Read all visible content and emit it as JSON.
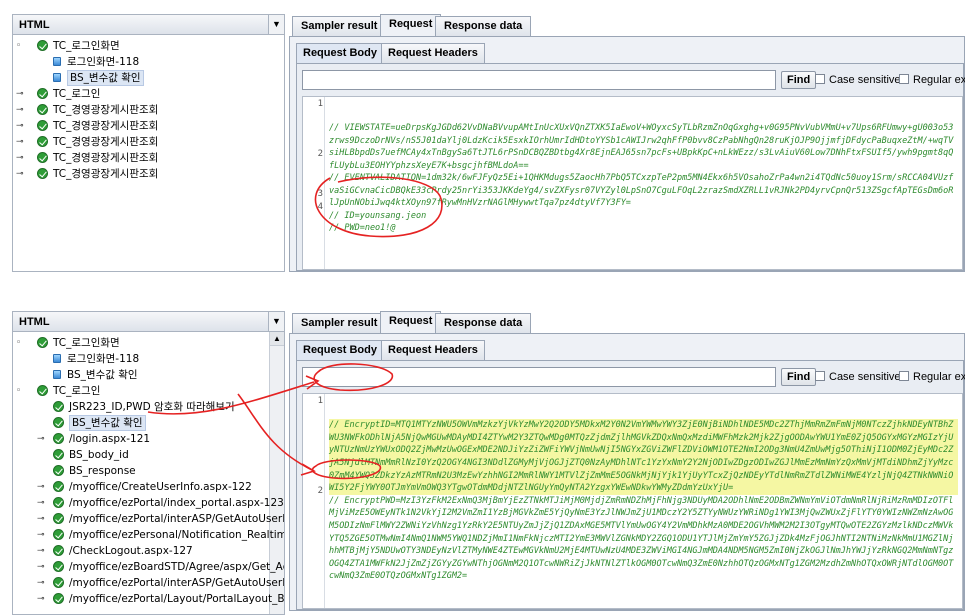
{
  "panel1": {
    "tree": {
      "header": "HTML",
      "nodes": [
        {
          "label": "TC_로그인화면"
        },
        {
          "label": "로그인화면-118"
        },
        {
          "label": "BS_변수값 확인"
        },
        {
          "label": "TC_로그인"
        },
        {
          "label": "TC_경영광장게시판조회"
        },
        {
          "label": "TC_경영광장게시판조회"
        },
        {
          "label": "TC_경영광장게시판조회"
        },
        {
          "label": "TC_경영광장게시판조회"
        },
        {
          "label": "TC_경영광장게시판조회"
        }
      ]
    },
    "tabs": [
      "Sampler result",
      "Request",
      "Response data"
    ],
    "subtabs": [
      "Request Body",
      "Request Headers"
    ],
    "find": {
      "button": "Find",
      "case": "Case sensitive",
      "regex": "Regular exp."
    },
    "lines": [
      {
        "n": "1",
        "text": "// VIEWSTATE=ueDrpsKgJGDd62VvDNaBVvupAMtInUcXUxVQnZTXK5IaEwoV+WOyxcSyTLbRzmZnOqGxghg+v0G95PNvVubVMmU+v7Ups6RFUmwy+gU003o53zrws9DczoDrNVs/nS5J01daYlj0LdzKcik5EsxkIOrhUmrIdHDtoYYSb1cAWIJrw2qhFfP0bvv8CzPabNhgQn28ruKjOJP9OjjmfjDFdycPaBuqxeZtM/+wqTVsiHLBbpdDs7uefMCAy4xTnBgySa6TtJTL6rPSnDCBQZBDtbg4Xr8EjnEAJ65sn7pcFs+UBpkKpC+nLkWEzz/s3LvAiuV60Low7DNhFtxFSUIf5/ywh9pgmt8qQfLUybLu3EOHYYphzsXeyE7K+bsgcjhfBMLdoA=="
      },
      {
        "n": "2",
        "text": "// EVENTVALIDATION=1dm32k/6wFJFyQz5Ei+1QHKMdugs5ZaocHh7PbQ5TCxzpTeP2pm5MN4Ekx6h5VOsahoZrPa4wn2i4TQdNc50uoy1Srm/sRCCA04VUzfvaSiGCvnaCicDBQkE33cPrdy25nrYi353JKKdeYg4/svZXFysr07VYZyl0LpSnO7CguLFOqL2zrazSmdXZRLL1vRJNk2PD4yrvCpnQr513ZSgcfApTEGsDm6oRlJpUnNObiJwq4ktXOyn97fRywMnHVzrNAGlMHywwtTqa7pz4dtyVf7Y3FY="
      },
      {
        "n": "3",
        "text": "// ID=younsang.jeon"
      },
      {
        "n": "4",
        "text": "// PWD=neo1!@"
      }
    ]
  },
  "panel2": {
    "tree": {
      "header": "HTML",
      "nodes": [
        {
          "label": "TC_로그인화면"
        },
        {
          "label": "로그인화면-118"
        },
        {
          "label": "BS_변수값 확인"
        },
        {
          "label": "TC_로그인"
        },
        {
          "label": "JSR223_ID,PWD 암호화 따라해보기"
        },
        {
          "label": "BS_변수값 확인"
        },
        {
          "label": "/login.aspx-121"
        },
        {
          "label": "BS_body_id"
        },
        {
          "label": "BS_response"
        },
        {
          "label": "/myoffice/CreateUserInfo.aspx-122"
        },
        {
          "label": "/myoffice/ezPortal/index_portal.aspx-123"
        },
        {
          "label": "/myoffice/ezPortal/interASP/GetAutoUserLoc"
        },
        {
          "label": "/myoffice/ezPersonal/Notification_Realtime"
        },
        {
          "label": "/CheckLogout.aspx-127"
        },
        {
          "label": "/myoffice/ezBoardSTD/Agree/aspx/Get_Agre"
        },
        {
          "label": "/myoffice/ezPortal/interASP/GetAutoUserLoc"
        },
        {
          "label": "/myoffice/ezPortal/Layout/PortalLayout_Bas"
        }
      ]
    },
    "tabs": [
      "Sampler result",
      "Request",
      "Response data"
    ],
    "subtabs": [
      "Request Body",
      "Request Headers"
    ],
    "find": {
      "button": "Find",
      "case": "Case sensitive",
      "regex": "Regular ex"
    },
    "lines": [
      {
        "n": "1",
        "text": "// EncryptID=MTQ1MTYzNWU5OWVmMzkzYjVkYzMwY2Q2ODY5MDkxM2Y0N2VmYWMwYWY3ZjE0NjBiNDhlNDE5MDc2ZThjMmRmZmFmNjM0NTczZjhkNDEyNTBhZWU3NWFkODhlNjA5NjQwMGUwMDAyMDI4ZTYwM2Y3ZTQwMDg0MTQzZjdmZjlhMGVkZDQxNmQxMzdiMWFhMzk2Mjk2ZjgOODAwYWU1YmE0ZjQ5OGYxMGYzMGIzYjUyNTUzNmUzYWUxODQ2ZjMwMzUwOGExMDE2NDJiYzZiZWFiYWVjNmUwNjI5NGYxZGViZWFlZDViOWM1OTE2NmI2ODg3NmU4ZmUwMjg5OThiNjI1ODM0ZjEyMDc2ZjA5NjdlMTNmMmRlNzI0YzQ2OGY4NGI3NDdlZGMyMjVjOGJjZTQ0NzAyMDhlNTc1YzYxNmY2Y2NjODIwZDgzODIwZGJlMmEzMmNmYzQxMmVjMTdiNDhmZjYyMzc0ZmM4YWQ3ZDkzYzAzMTRmN2U3MzEwYzhhNGI2MmRlNWY1MTVlZjZmMmE5OGNkMjNjYjk1YjUyYTcxZjQzNDEyYTdlNmRmZTdlZWNiMWE4YzljNjQ4ZTNkNWNiOWI5Y2FjYWY0OTJmYmVmOWQ3YTgwOTdmMDdjNTZlNGUyYmQyNTA2YzgxYWEwNDkwYWMyZDdmYzUxYjU="
      },
      {
        "n": "2",
        "text": "// EncryptPWD=MzI3YzFkM2ExNmQ3MjBmYjEzZTNkMTJiMjM0MjdjZmRmNDZhMjFhNjg3NDUyMDA2ODhlNmE2ODBmZWNmYmViOTdmNmRlNjRiMzRmMDIzOTFlMjViMzE5OWEyNTk1N2VkYjI2M2VmZmI1YzBjMGVkZmE5YjQyNmE3YzJlNWJmZjU1MDczY2Y5ZTYyNWUzYWRiNDg1YWI3MjQwZWUxZjFlYTY0YWIzNWZmNzAwOGM5ODIzNmFlMWY2ZWNiYzVhNzg1YzRkY2E5NTUyZmJjZjQ1ZDAxMGE5MTVlYmUwOGY4Y2VmMDhkMzA0MDE2OGVhMWM2M2I3OTgyMTQwOTE2ZGYzMzlkNDczMWVkYTQ5ZGE5OTMwNmI4NmQ1NWM5YWQ1NDZjMmI1NmFkNjczMTI2YmE3MWVlZGNkMDY2ZGQ1ODU1YTJlMjZmYmY5ZGJjZDk4MzFjOGJhNTI2NTNiMzNkMmU1MGZlNjhhMTBjMjY5NDUwOTY3NDEyNzVlZTMyNWE4ZTEwMGVkNmU2MjE4MTUwNzU4MDE3ZWViMGI4NGJmMDA4NDM5NGM5ZmI0NjZkOGJlNmJhYWJjYzRkNGQ2MmNmNTgzOGQ4ZTA1MWFkN2JjZmZjZGYyZGYwNThjOGNmM2Q1OTcwNWRiZjJkNTNlZTlkOGM0OTcwNmQ3ZmE0NzhhOTQzOGMxNTg1ZGM2MzdhZmNhOTQxOWRjNTdlOGM0OTcwNmQ3ZmE0OTQzOGMxNTg1ZGM2="
      }
    ]
  }
}
